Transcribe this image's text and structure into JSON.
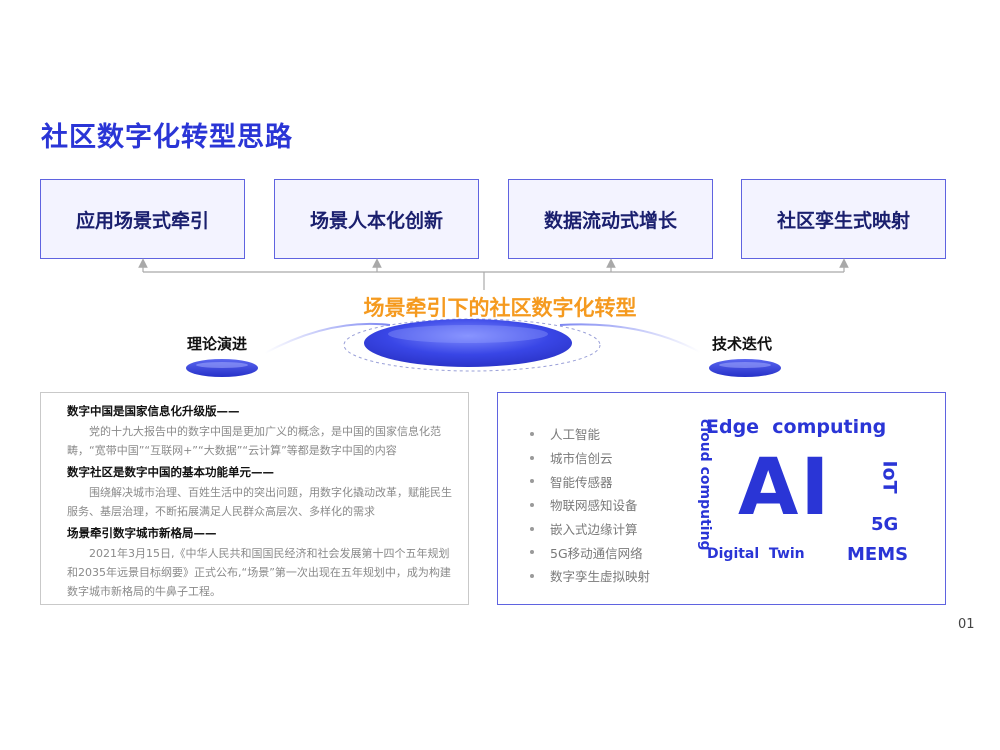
{
  "title": "社区数字化转型思路",
  "top_boxes": [
    "应用场景式牵引",
    "场景人本化创新",
    "数据流动式增长",
    "社区孪生式映射"
  ],
  "center_title": "场景牵引下的社区数字化转型",
  "left_label": "理论演进",
  "right_label": "技术迭代",
  "left_panel": [
    {
      "heading": "数字中国是国家信息化升级版——",
      "text": "党的十九大报告中的数字中国是更加广义的概念，是中国的国家信息化范畴，“宽带中国”“互联网+”“大数据”“云计算”等都是数字中国的内容"
    },
    {
      "heading": "数字社区是数字中国的基本功能单元——",
      "text": "围绕解决城市治理、百姓生活中的突出问题，用数字化撬动改革，赋能民生服务、基层治理，不断拓展满足人民群众高层次、多样化的需求"
    },
    {
      "heading": "场景牵引数字城市新格局——",
      "text": "2021年3月15日,《中华人民共和国国民经济和社会发展第十四个五年规划和2035年远景目标纲要》正式公布,“场景”第一次出现在五年规划中，成为构建数字城市新格局的牛鼻子工程。"
    }
  ],
  "tech_list": [
    "人工智能",
    "城市信创云",
    "智能传感器",
    "物联网感知设备",
    "嵌入式边缘计算",
    "5G移动通信网络",
    "数字孪生虚拟映射"
  ],
  "word_cloud": {
    "edge": "Edge  computing",
    "cloud": "cloud computing",
    "ai": "AI",
    "iot": "IoT",
    "fiveg": "5G",
    "twin": "Digital  Twin",
    "mems": "MEMS"
  },
  "page_number": "01",
  "colors": {
    "accent": "#2a35d6",
    "orange": "#f59a1f",
    "border": "#5f63e0"
  }
}
